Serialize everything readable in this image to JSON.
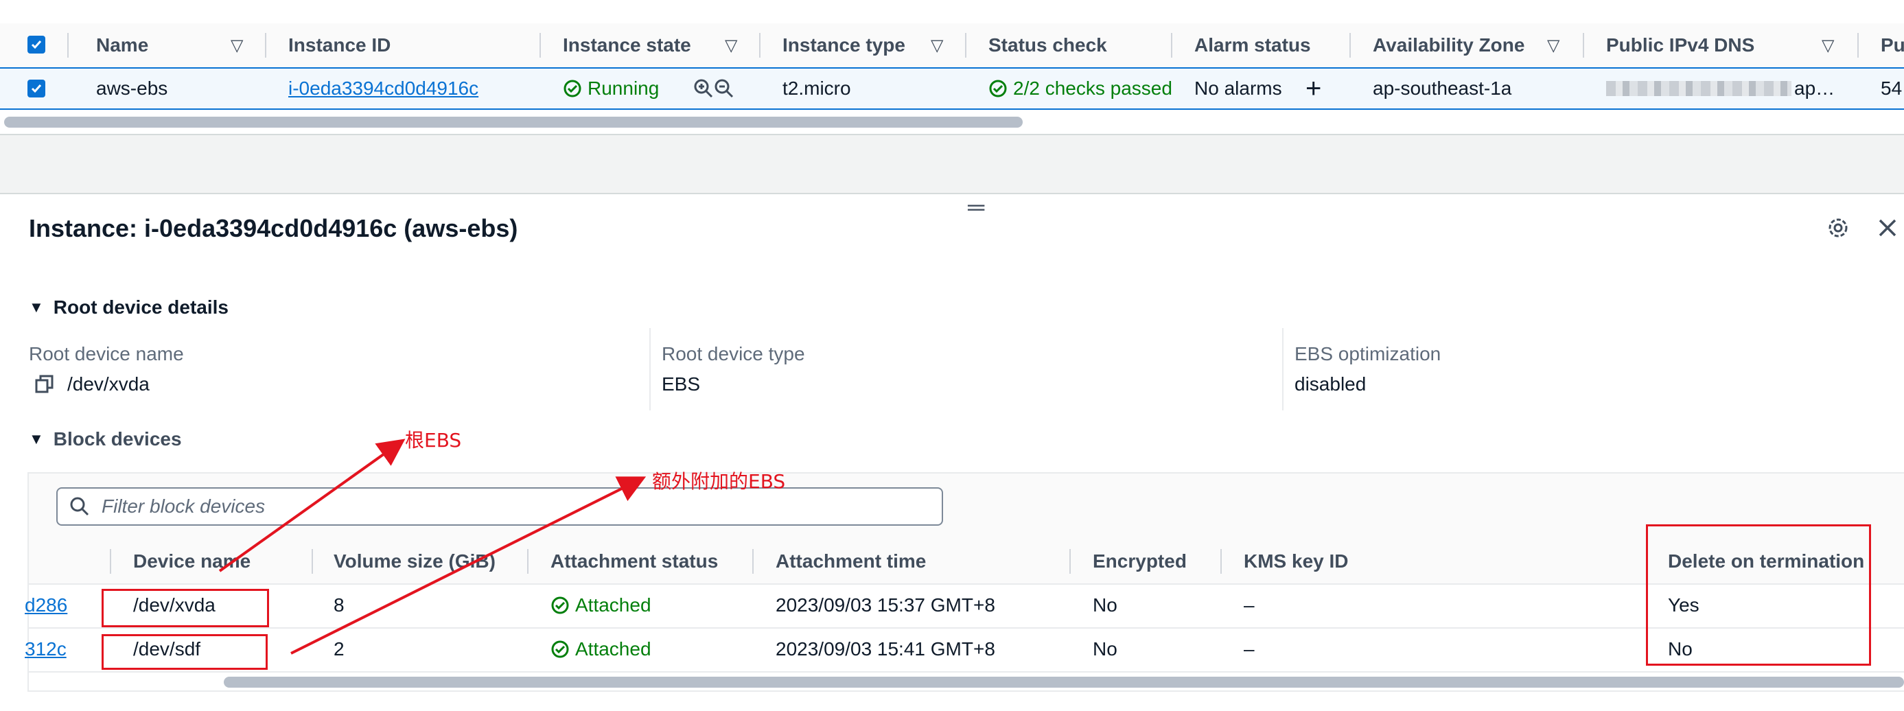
{
  "instances_table": {
    "columns": [
      "Name",
      "Instance ID",
      "Instance state",
      "Instance type",
      "Status check",
      "Alarm status",
      "Availability Zone",
      "Public IPv4 DNS",
      "Pu"
    ],
    "row": {
      "name": "aws-ebs",
      "instance_id": "i-0eda3394cd0d4916c",
      "state": "Running",
      "type": "t2.micro",
      "status_check": "2/2 checks passed",
      "alarm_status": "No alarms",
      "availability_zone": "ap-southeast-1a",
      "public_dns_suffix": "ap…",
      "public_ip_partial": "54"
    }
  },
  "details": {
    "title": "Instance: i-0eda3394cd0d4916c (aws-ebs)",
    "root_section_title": "Root device details",
    "root_device_name_label": "Root device name",
    "root_device_name_value": "/dev/xvda",
    "root_device_type_label": "Root device type",
    "root_device_type_value": "EBS",
    "ebs_optimization_label": "EBS optimization",
    "ebs_optimization_value": "disabled",
    "block_section_title": "Block devices"
  },
  "block_devices": {
    "filter_placeholder": "Filter block devices",
    "columns": [
      "Device name",
      "Volume size (GiB)",
      "Attachment status",
      "Attachment time",
      "Encrypted",
      "KMS key ID",
      "Delete on termination"
    ],
    "rows": [
      {
        "volume_id_tail": "d286",
        "device": "/dev/xvda",
        "size": "8",
        "status": "Attached",
        "time": "2023/09/03 15:37 GMT+8",
        "encrypted": "No",
        "kms": "–",
        "delete_on_termination": "Yes"
      },
      {
        "volume_id_tail": "312c",
        "device": "/dev/sdf",
        "size": "2",
        "status": "Attached",
        "time": "2023/09/03 15:41 GMT+8",
        "encrypted": "No",
        "kms": "–",
        "delete_on_termination": "No"
      }
    ]
  },
  "annotations": {
    "root_ebs": "根EBS",
    "extra_ebs": "额外附加的EBS"
  },
  "colors": {
    "aws_blue": "#0972d3",
    "success_green": "#037f0c",
    "annotation_red": "#e3141f"
  }
}
